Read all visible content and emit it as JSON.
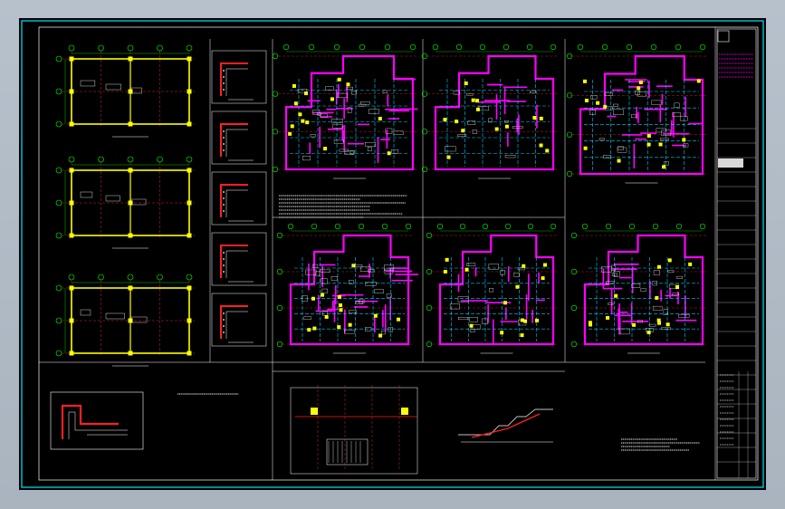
{
  "window": {
    "background_top": "#b7c1cc",
    "background_bottom": "#aab4bf"
  },
  "colors": {
    "paper": "#000000",
    "frame": "#00e5ff",
    "sheet_border": "#ffffff",
    "column": "#ffff00",
    "wall": "#ff00ff",
    "axis": "#ff3030",
    "grid_bubble": "#00ff00",
    "dimension": "#00ff00",
    "hidden_line": "#00ccff",
    "text": "#e8e8e8",
    "hatch": "#ffffff",
    "rebar": "#ff2020"
  },
  "drawing": {
    "icons": [
      "frame-icon",
      "column-icon",
      "wall-icon",
      "axis-line-icon",
      "grid-bubble-icon"
    ]
  }
}
